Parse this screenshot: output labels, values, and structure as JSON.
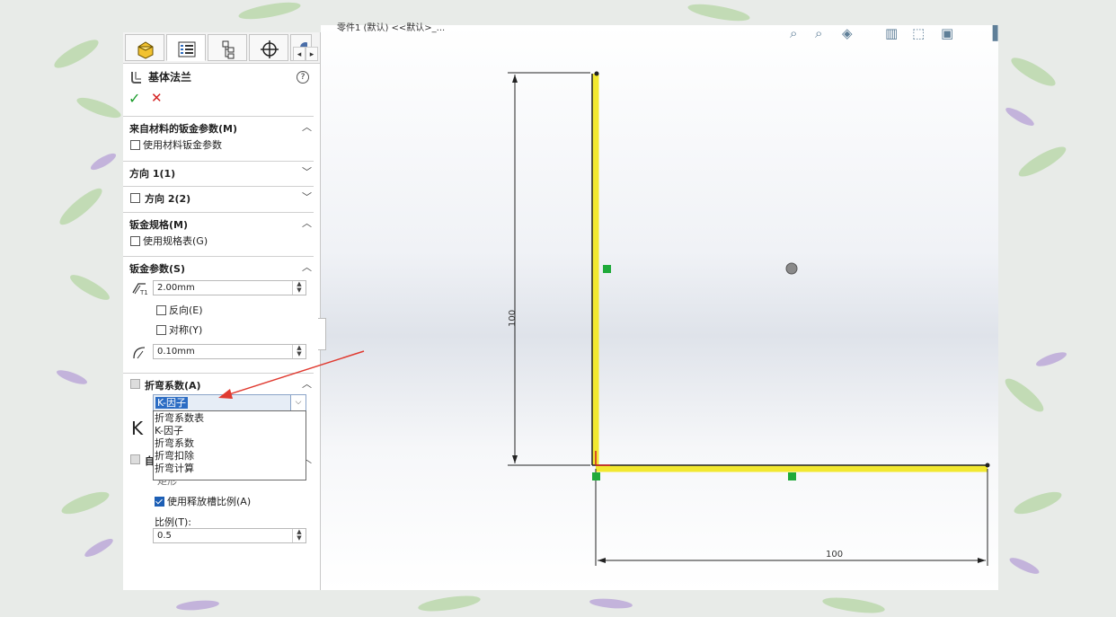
{
  "property_manager": {
    "title": "基体法兰",
    "help_icon": "?",
    "sections": {
      "material": {
        "label": "来自材料的钣金参数(M)",
        "checkbox_label": "使用材料钣金参数"
      },
      "direction1": {
        "label": "方向 1(1)"
      },
      "direction2": {
        "label": "方向 2(2)"
      },
      "gauge": {
        "label": "钣金规格(M)",
        "checkbox_label": "使用规格表(G)"
      },
      "params": {
        "label": "钣金参数(S)",
        "thickness": "2.00mm",
        "reverse_label": "反向(E)",
        "symmetric_label": "对称(Y)",
        "radius": "0.10mm"
      },
      "bend_allowance": {
        "label": "折弯系数(A)",
        "selected": "K-因子",
        "options": [
          "折弯系数表",
          "K-因子",
          "折弯系数",
          "折弯扣除",
          "折弯计算"
        ],
        "k_label": "K"
      },
      "relief": {
        "label_partial": "自",
        "type_partial": "矩形",
        "ratio_checkbox_label": "使用释放槽比例(A)",
        "ratio_label": "比例(T):",
        "ratio_value": "0.5"
      }
    }
  },
  "viewport": {
    "breadcrumb": "零件1 (默认) <<默认>_...",
    "dimension_vertical": "100",
    "dimension_horizontal": "100"
  },
  "colors": {
    "sketch_highlight": "#f2e830",
    "constraint_green": "#1faa3a",
    "annotation_arrow": "#e03a30"
  }
}
